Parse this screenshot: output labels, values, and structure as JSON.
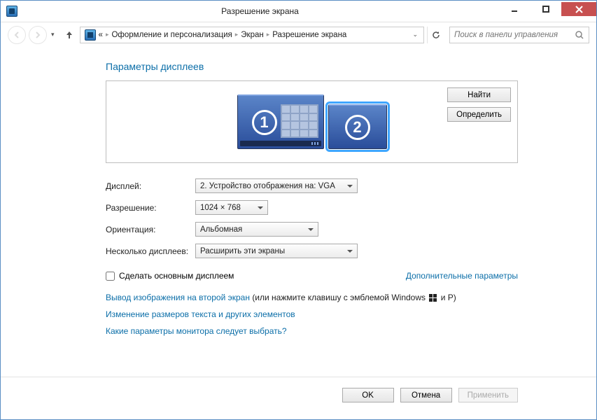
{
  "window": {
    "title": "Разрешение экрана"
  },
  "nav": {
    "ellipsis": "«",
    "crumb1": "Оформление и персонализация",
    "crumb2": "Экран",
    "crumb3": "Разрешение экрана",
    "search_placeholder": "Поиск в панели управления"
  },
  "section": {
    "title": "Параметры дисплеев"
  },
  "panel": {
    "find": "Найти",
    "identify": "Определить",
    "monitor1": "1",
    "monitor2": "2"
  },
  "form": {
    "display_label": "Дисплей:",
    "display_value": "2. Устройство отображения на: VGA",
    "resolution_label": "Разрешение:",
    "resolution_value": "1024 × 768",
    "orientation_label": "Ориентация:",
    "orientation_value": "Альбомная",
    "multi_label": "Несколько дисплеев:",
    "multi_value": "Расширить эти экраны"
  },
  "checkbox": {
    "label": "Сделать основным дисплеем",
    "advanced": "Дополнительные параметры"
  },
  "links": {
    "second_screen": "Вывод изображения на второй экран",
    "second_screen_suffix1": " (или нажмите клавишу с эмблемой Windows ",
    "second_screen_suffix2": " и P)",
    "text_size": "Изменение размеров текста и других элементов",
    "which_settings": "Какие параметры монитора следует выбрать?"
  },
  "footer": {
    "ok": "OK",
    "cancel": "Отмена",
    "apply": "Применить"
  }
}
